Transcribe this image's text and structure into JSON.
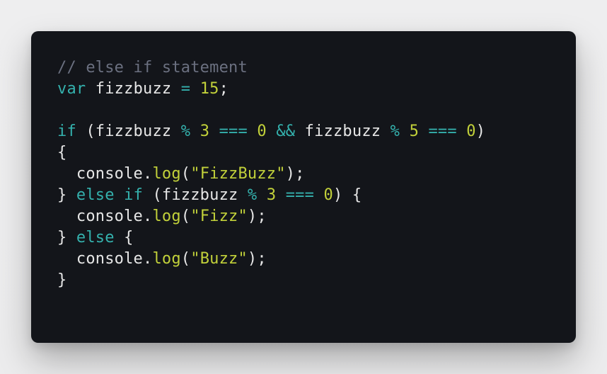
{
  "colors": {
    "background": "#ececed",
    "editor_background": "#13151a",
    "plain": "#e6e6e6",
    "comment": "#6b7080",
    "keyword": "#34b1ad",
    "literal": "#c2d13a"
  },
  "code": {
    "lines": [
      [
        {
          "t": "// else if statement",
          "k": "comment"
        }
      ],
      [
        {
          "t": "var",
          "k": "keyword"
        },
        {
          "t": " fizzbuzz ",
          "k": "plain"
        },
        {
          "t": "=",
          "k": "operator"
        },
        {
          "t": " ",
          "k": "plain"
        },
        {
          "t": "15",
          "k": "number"
        },
        {
          "t": ";",
          "k": "plain"
        }
      ],
      [],
      [
        {
          "t": "if",
          "k": "keyword"
        },
        {
          "t": " (fizzbuzz ",
          "k": "plain"
        },
        {
          "t": "%",
          "k": "operator"
        },
        {
          "t": " ",
          "k": "plain"
        },
        {
          "t": "3",
          "k": "number"
        },
        {
          "t": " ",
          "k": "plain"
        },
        {
          "t": "===",
          "k": "operator"
        },
        {
          "t": " ",
          "k": "plain"
        },
        {
          "t": "0",
          "k": "number"
        },
        {
          "t": " ",
          "k": "plain"
        },
        {
          "t": "&&",
          "k": "operator"
        },
        {
          "t": " fizzbuzz ",
          "k": "plain"
        },
        {
          "t": "%",
          "k": "operator"
        },
        {
          "t": " ",
          "k": "plain"
        },
        {
          "t": "5",
          "k": "number"
        },
        {
          "t": " ",
          "k": "plain"
        },
        {
          "t": "===",
          "k": "operator"
        },
        {
          "t": " ",
          "k": "plain"
        },
        {
          "t": "0",
          "k": "number"
        },
        {
          "t": ")",
          "k": "plain"
        }
      ],
      [
        {
          "t": "{",
          "k": "plain"
        }
      ],
      [
        {
          "t": "  console.",
          "k": "plain"
        },
        {
          "t": "log",
          "k": "method"
        },
        {
          "t": "(",
          "k": "plain"
        },
        {
          "t": "\"FizzBuzz\"",
          "k": "string"
        },
        {
          "t": ");",
          "k": "plain"
        }
      ],
      [
        {
          "t": "} ",
          "k": "plain"
        },
        {
          "t": "else",
          "k": "keyword"
        },
        {
          "t": " ",
          "k": "plain"
        },
        {
          "t": "if",
          "k": "keyword"
        },
        {
          "t": " (fizzbuzz ",
          "k": "plain"
        },
        {
          "t": "%",
          "k": "operator"
        },
        {
          "t": " ",
          "k": "plain"
        },
        {
          "t": "3",
          "k": "number"
        },
        {
          "t": " ",
          "k": "plain"
        },
        {
          "t": "===",
          "k": "operator"
        },
        {
          "t": " ",
          "k": "plain"
        },
        {
          "t": "0",
          "k": "number"
        },
        {
          "t": ") {",
          "k": "plain"
        }
      ],
      [
        {
          "t": "  console.",
          "k": "plain"
        },
        {
          "t": "log",
          "k": "method"
        },
        {
          "t": "(",
          "k": "plain"
        },
        {
          "t": "\"Fizz\"",
          "k": "string"
        },
        {
          "t": ");",
          "k": "plain"
        }
      ],
      [
        {
          "t": "} ",
          "k": "plain"
        },
        {
          "t": "else",
          "k": "keyword"
        },
        {
          "t": " {",
          "k": "plain"
        }
      ],
      [
        {
          "t": "  console.",
          "k": "plain"
        },
        {
          "t": "log",
          "k": "method"
        },
        {
          "t": "(",
          "k": "plain"
        },
        {
          "t": "\"Buzz\"",
          "k": "string"
        },
        {
          "t": ");",
          "k": "plain"
        }
      ],
      [
        {
          "t": "}",
          "k": "plain"
        }
      ]
    ]
  }
}
